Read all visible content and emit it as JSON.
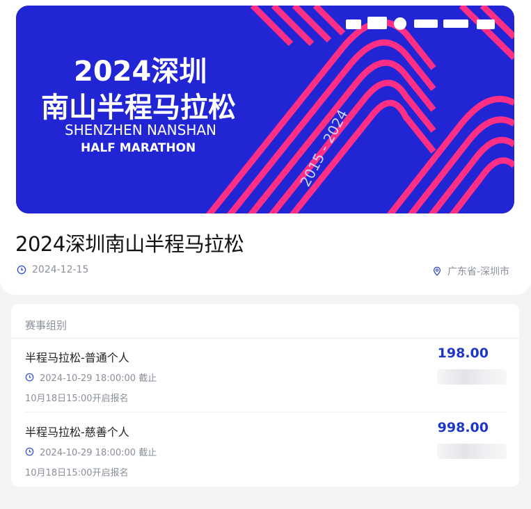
{
  "event": {
    "banner": {
      "title_line1": "2024深圳",
      "title_line2": "南山半程马拉松",
      "subtitle_line1": "SHENZHEN NANSHAN",
      "subtitle_line2": "HALF MARATHON",
      "years": "2015 - 2024"
    },
    "title": "2024深圳南山半程马拉松",
    "date": "2024-12-15",
    "location": "广东省-深圳市"
  },
  "groups": {
    "header": "赛事组别",
    "items": [
      {
        "name": "半程马拉松-普通个人",
        "price": "198.00",
        "deadline": "2024-10-29 18:00:00 截止",
        "opening": "10月18日15:00开启报名"
      },
      {
        "name": "半程马拉松-慈善个人",
        "price": "998.00",
        "deadline": "2024-10-29 18:00:00 截止",
        "opening": "10月18日15:00开启报名"
      }
    ]
  },
  "colors": {
    "banner_blue": "#1f27d6",
    "track_pink": "#ff2f86",
    "price_blue": "#1d38c4"
  }
}
